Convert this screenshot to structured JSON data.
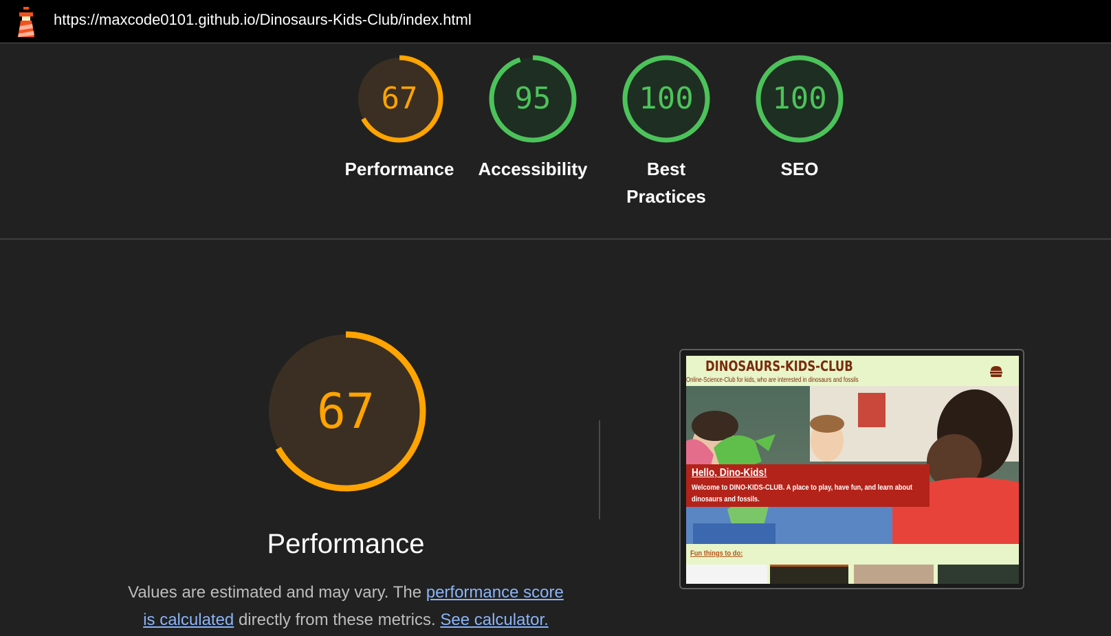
{
  "browser": {
    "url": "https://maxcode0101.github.io/Dinosaurs-Kids-Club/index.html",
    "logo_icon": "lighthouse-icon"
  },
  "categories": [
    {
      "score": 67,
      "label": "Performance",
      "color": "#ffa400",
      "track": "#3a2f22",
      "fill": 0.67
    },
    {
      "score": 95,
      "label": "Accessibility",
      "color": "#4cc35a",
      "track": "#1f2e22",
      "fill": 0.95
    },
    {
      "score": 100,
      "label": "Best Practices",
      "color": "#4cc35a",
      "track": "#1f2e22",
      "fill": 1.0
    },
    {
      "score": 100,
      "label": "SEO",
      "color": "#4cc35a",
      "track": "#1f2e22",
      "fill": 1.0
    }
  ],
  "performance": {
    "score": 67,
    "fill": 0.67,
    "title": "Performance",
    "description_before": "Values are estimated and may vary. The ",
    "link1": "performance score is calculated",
    "description_middle": " directly from these metrics. ",
    "link2": "See calculator.",
    "color": "#ffa400"
  },
  "screenshot": {
    "site_title": "DINOSAURS-KIDS-CLUB",
    "site_subtitle": "Online-Science-Club for kids, who are interested in dinosaurs and fossils",
    "menu_icon": "hamburger-icon",
    "hello_title": "Hello, Dino-Kids!",
    "hello_text": "Welcome to DINO-KIDS-CLUB. A place to play, have fun, and learn about dinosaurs and fossils.",
    "fun_label": "Fun things to do:"
  }
}
